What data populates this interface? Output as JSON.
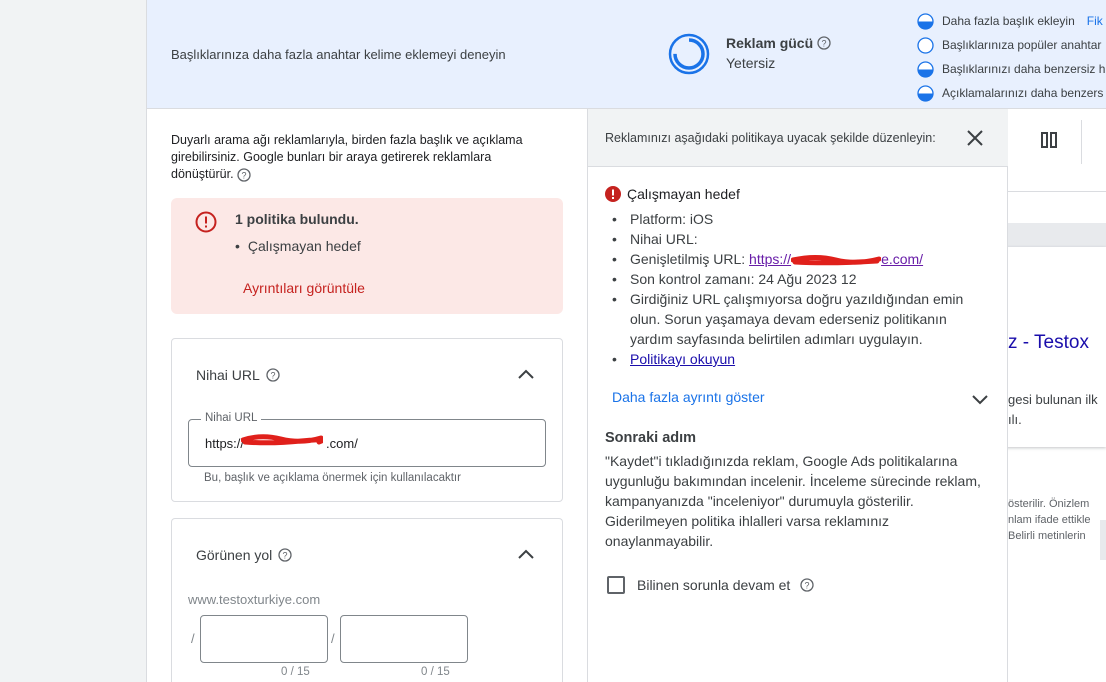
{
  "banner": {
    "hint": "Başlıklarınıza daha fazla anahtar kelime eklemeyi deneyin",
    "strength_label": "Reklam gücü",
    "strength_value": "Yetersiz",
    "suggestions": [
      {
        "text": "Daha fazla başlık ekleyin",
        "action": "Fik",
        "icon": "half-circle-icon"
      },
      {
        "text": "Başlıklarınıza popüler anahtar",
        "icon": "empty-circle-icon"
      },
      {
        "text": "Başlıklarınızı daha benzersiz h",
        "icon": "half-circle-icon"
      },
      {
        "text": "Açıklamalarınızı daha benzers",
        "icon": "half-circle-icon"
      }
    ]
  },
  "intro": {
    "text": "Duyarlı arama ağı reklamlarıyla, birden fazla başlık ve açıklama girebilirsiniz. Google bunları bir araya getirerek reklamlara dönüştürür."
  },
  "policy_alert": {
    "title": "1 politika bulundu.",
    "items": [
      "Çalışmayan hedef"
    ],
    "link": "Ayrıntıları görüntüle"
  },
  "final_url": {
    "section_title": "Nihai URL",
    "field_label": "Nihai URL",
    "value_prefix": "https://",
    "value_suffix": ".com/",
    "helper": "Bu, başlık ve açıklama önermek için kullanılacaktır"
  },
  "display_path": {
    "section_title": "Görünen yol",
    "domain": "www.testoxturkiye.com",
    "slash": "/",
    "path1_count": "0 / 15",
    "path2_count": "0 / 15"
  },
  "panel": {
    "header": "Reklamınızı aşağıdaki politikaya uyacak şekilde düzenleyin:",
    "error_title": "Çalışmayan hedef",
    "platform": "Platform: iOS",
    "final_url": "Nihai URL:",
    "expanded_url_label": "Genişletilmiş URL: ",
    "expanded_url_prefix": "https://",
    "expanded_url_suffix": "e.com/",
    "last_check": "Son kontrol zamanı: 24 Ağu 2023 12",
    "instruction": "Girdiğiniz URL çalışmıyorsa doğru yazıldığından emin olun. Sorun yaşamaya devam ederseniz politikanın yardım sayfasında belirtilen adımları uygulayın.",
    "read_policy": "Politikayı okuyun",
    "more_details": "Daha fazla ayrıntı göster",
    "next_title": "Sonraki adım",
    "next_body": "\"Kaydet\"i tıkladığınızda reklam, Google Ads politikalarına uygunluğu bakımından incelenir. İnceleme sürecinde reklam, kampanyanızda \"inceleniyor\" durumuyla gösterilir. Giderilmeyen politika ihlalleri varsa reklamınız onaylanmayabilir.",
    "checkbox_label": "Bilinen sorunla devam et"
  },
  "preview": {
    "headline": "z - Testox",
    "desc_line1": "gesi bulunan ilk",
    "desc_line2": "ılı.",
    "foot_line1": "österilir. Önizlem",
    "foot_line2": "nlam ifade ettikle",
    "foot_line3": "Belirli metinlerin"
  },
  "colors": {
    "accent": "#1a73e8",
    "banner_bg": "#e8f0fe",
    "alert_bg": "#fce8e6",
    "alert_text": "#c5221f",
    "redaction": "#e0201b"
  }
}
